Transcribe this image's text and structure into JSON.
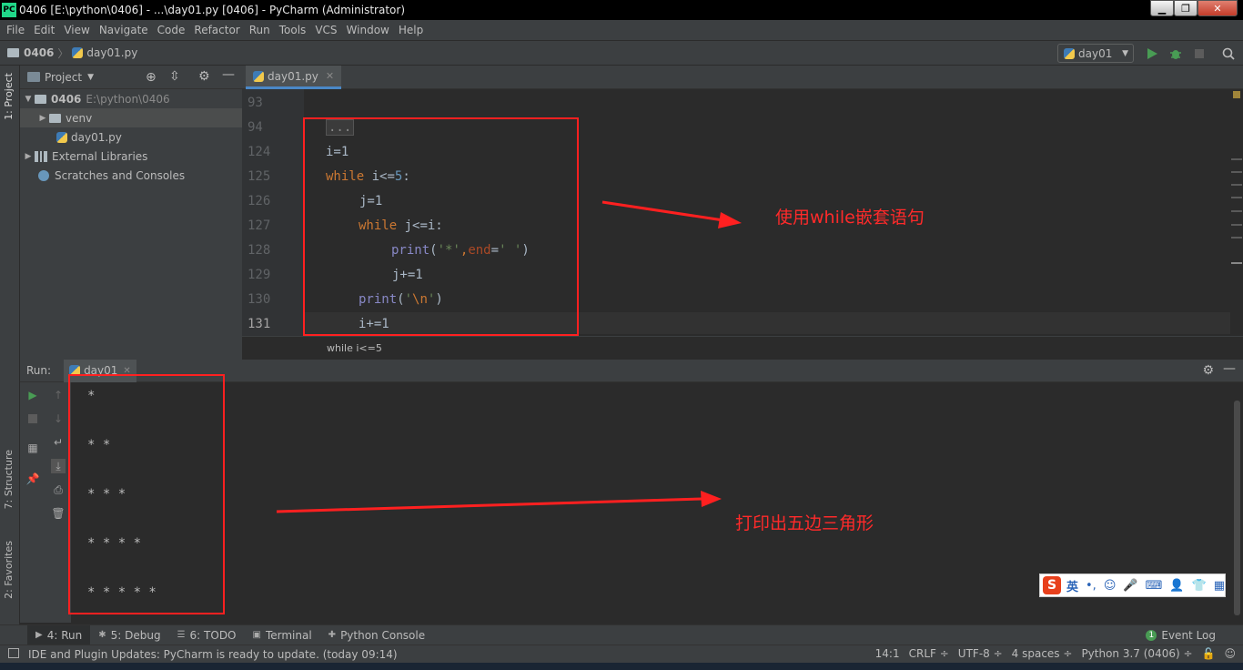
{
  "window": {
    "title": "0406 [E:\\python\\0406] - ...\\day01.py [0406] - PyCharm (Administrator)",
    "app_icon": "PC",
    "minimize": "▁",
    "maximize": "❐",
    "close": "✕"
  },
  "menu": [
    "File",
    "Edit",
    "View",
    "Navigate",
    "Code",
    "Refactor",
    "Run",
    "Tools",
    "VCS",
    "Window",
    "Help"
  ],
  "nav": {
    "root": "0406",
    "separator": "〉",
    "file": "day01.py",
    "run_config": "day01"
  },
  "left_stripe": {
    "project_tab": "1: Project",
    "structure_tab": "7: Structure",
    "favorites_tab": "2: Favorites"
  },
  "project": {
    "header": "Project",
    "tree": [
      {
        "label": "0406",
        "path": "E:\\python\\0406"
      },
      {
        "label": "venv"
      },
      {
        "label": "day01.py"
      },
      {
        "label": "External Libraries"
      },
      {
        "label": "Scratches and Consoles"
      }
    ]
  },
  "editor": {
    "tab": "day01.py",
    "line_numbers": [
      "93",
      "94",
      "124",
      "125",
      "126",
      "127",
      "128",
      "129",
      "130",
      "131"
    ],
    "code": {
      "l94": "...",
      "l124": "i=1",
      "l125_kw": "while",
      "l125_rest": " i<=",
      "l125_num": "5",
      "l125_end": ":",
      "l126": "j=1",
      "l127_kw": "while",
      "l127_rest": " j<=i:",
      "l128_fn": "print",
      "l128_a": "(",
      "l128_s1": "'*'",
      "l128_b": ",",
      "l128_kwarg": "end",
      "l128_eq": "=",
      "l128_s2": "' '",
      "l128_c": ")",
      "l129": "j+=1",
      "l130_fn": "print",
      "l130_a": "(",
      "l130_q1": "'",
      "l130_esc": "\\n",
      "l130_q2": "'",
      "l130_b": ")",
      "l131": "i+=1"
    },
    "breadcrumb": "while i<=5"
  },
  "run": {
    "label": "Run:",
    "tab": "day01",
    "output": [
      "*",
      "* *",
      "* * *",
      "* * * *",
      "* * * * *"
    ]
  },
  "bottom_tools": [
    {
      "icon": "▶",
      "label": "4: Run"
    },
    {
      "icon": "✱",
      "label": "5: Debug"
    },
    {
      "icon": "☰",
      "label": "6: TODO"
    },
    {
      "icon": "▣",
      "label": "Terminal"
    },
    {
      "icon": "✚",
      "label": "Python Console"
    }
  ],
  "event_log": {
    "count": "1",
    "label": "Event Log"
  },
  "status": {
    "message": "IDE and Plugin Updates: PyCharm is ready to update. (today 09:14)",
    "position": "14:1",
    "line_sep": "CRLF ÷",
    "encoding": "UTF-8 ÷",
    "indent": "4 spaces ÷",
    "interpreter": "Python 3.7 (0406) ÷"
  },
  "annotations": {
    "top_note": "使用while嵌套语句",
    "bottom_note": "打印出五边三角形"
  },
  "ime": {
    "logo": "S",
    "mode": "英"
  },
  "colors": {
    "annotation_red": "#ff2020",
    "keyword": "#cc7832",
    "number": "#6897bb",
    "string": "#6a8759",
    "builtin": "#8888c6"
  }
}
